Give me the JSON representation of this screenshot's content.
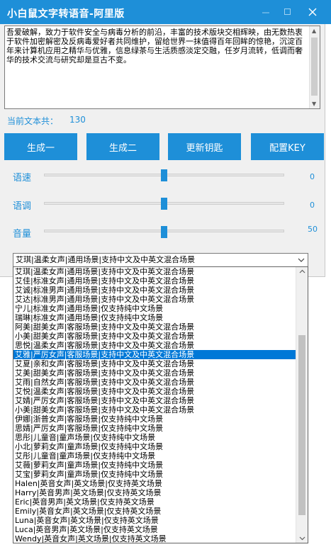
{
  "window": {
    "title": "小白鼠文字转语音-阿里版",
    "accent": "#1e8fd8"
  },
  "text": {
    "content": "吾爱破解，致力于软件安全与病毒分析的前沿，丰富的技术版块交相辉映，由无数热衷于软件加密解密及反病毒爱好者共同维护，留给世界一抹值得百年回眸的惊艳，沉淀百年来计算机应用之精华与优雅，信息绿茶与生活质感淡定交融，任岁月流转，低调而奢华的技术交流与研究却是亘古不变。",
    "count_label": "当前文本共：",
    "count_value": "130"
  },
  "buttons": {
    "gen1": "生成一",
    "gen2": "生成二",
    "refresh_key": "更新钥匙",
    "config_key": "配置KEY"
  },
  "sliders": {
    "speed": {
      "label": "语速",
      "value": "0",
      "fraction": 0.5
    },
    "pitch": {
      "label": "语调",
      "value": "0",
      "fraction": 0.5
    },
    "volume": {
      "label": "音量",
      "value": "50",
      "fraction": 0.5
    }
  },
  "voice_select": {
    "selected": "艾琪|温柔女声|通用场景|支持中文及中英文混合场景",
    "selected_index": 9,
    "options": [
      "艾琪|温柔女声|通用场景|支持中文及中英文混合场景",
      "艾佳|标准女声|通用场景|支持中文及中英文混合场景",
      "艾诚|标准男声|通用场景|支持中文及中英文混合场景",
      "艾达|标准男声|通用场景|支持中文及中英文混合场景",
      "宁儿|标准女声|通用场景|仅支持纯中文场景",
      "瑞琳|标准女声|通用场景|仅支持纯中文场景",
      "阿美|甜美女声|客服场景|支持中文及中英文混合场景",
      "小美|甜美女声|客服场景|支持中文及中英文混合场景",
      "思悦|温柔女声|客服场景|支持中文及中英文混合场景",
      "艾雅|严厉女声|客服场景|支持中文及中英文混合场景",
      "艾夏|亲和女声|客服场景|支持中文及中英文混合场景",
      "艾美|甜美女声|客服场景|支持中文及中英文混合场景",
      "艾雨|自然女声|客服场景|支持中文及中英文混合场景",
      "艾悦|温柔女声|客服场景|支持中文及中英文混合场景",
      "艾婧|严厉女声|客服场景|支持中文及中英文混合场景",
      "小美|甜美女声|客服场景|支持中文及中英文混合场景",
      "伊娜|浙普女声|客服场景|仅支持纯中文场景",
      "思婧|严厉女声|客服场景|仅支持纯中文场景",
      "思彤|儿童音|童声场景|仅支持纯中文场景",
      "小北|萝莉女声|童声场景|仅支持纯中文场景",
      "艾彤|儿童音|童声场景|仅支持纯中文场景",
      "艾薇|萝莉女声|童声场景|仅支持纯中文场景",
      "艾宝|萝莉女声|童声场景|仅支持纯中文场景",
      "Halen|英音女声|英文场景|仅支持英文场景",
      "Harry|英音男声|英文场景|仅支持英文场景",
      "Eric|英音男声|英文场景|仅支持英文场景",
      "Emily|英音女声|英文场景|仅支持英文场景",
      "Luna|英音女声|英文场景|仅支持英文场景",
      "Luca|英音男声|英文场景|仅支持英文场景",
      "Wendy|英音女声|英文场景|仅支持英文场景"
    ]
  }
}
